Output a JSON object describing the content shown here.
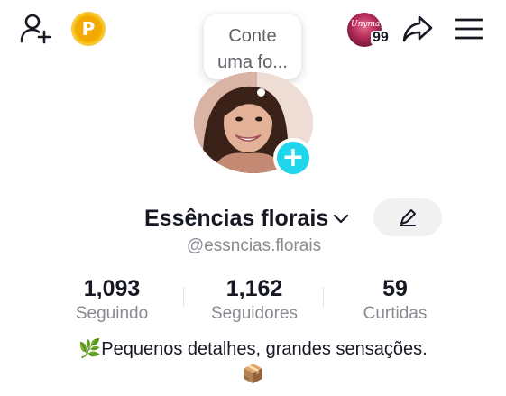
{
  "profile_prompt": {
    "bubble_line1": "Conte",
    "bubble_line2": "uma fo..."
  },
  "header": {
    "visitors_avatar_text": "Unyma",
    "visitors_count": "99",
    "coin_letter": "P"
  },
  "profile": {
    "display_name": "Essências florais",
    "handle": "@essncias.florais"
  },
  "stats": {
    "following": {
      "value": "1,093",
      "label": "Seguindo"
    },
    "followers": {
      "value": "1,162",
      "label": "Seguidores"
    },
    "likes": {
      "value": "59",
      "label": "Curtidas"
    }
  },
  "bio": {
    "line1": "🌿Pequenos detalhes, grandes sensações.",
    "line2": "📦"
  },
  "colors": {
    "accent": "#20d5ec",
    "coin": "#f7b500",
    "text_primary": "#161823",
    "text_secondary": "#8a8b91",
    "button_bg": "#f1f1f2"
  },
  "icons": {
    "add_friend": "add-person-icon",
    "coin": "coin-icon",
    "share": "share-arrow-icon",
    "menu": "hamburger-menu-icon",
    "edit": "pencil-icon",
    "chevron": "chevron-down-icon",
    "add_avatar": "plus-icon"
  }
}
